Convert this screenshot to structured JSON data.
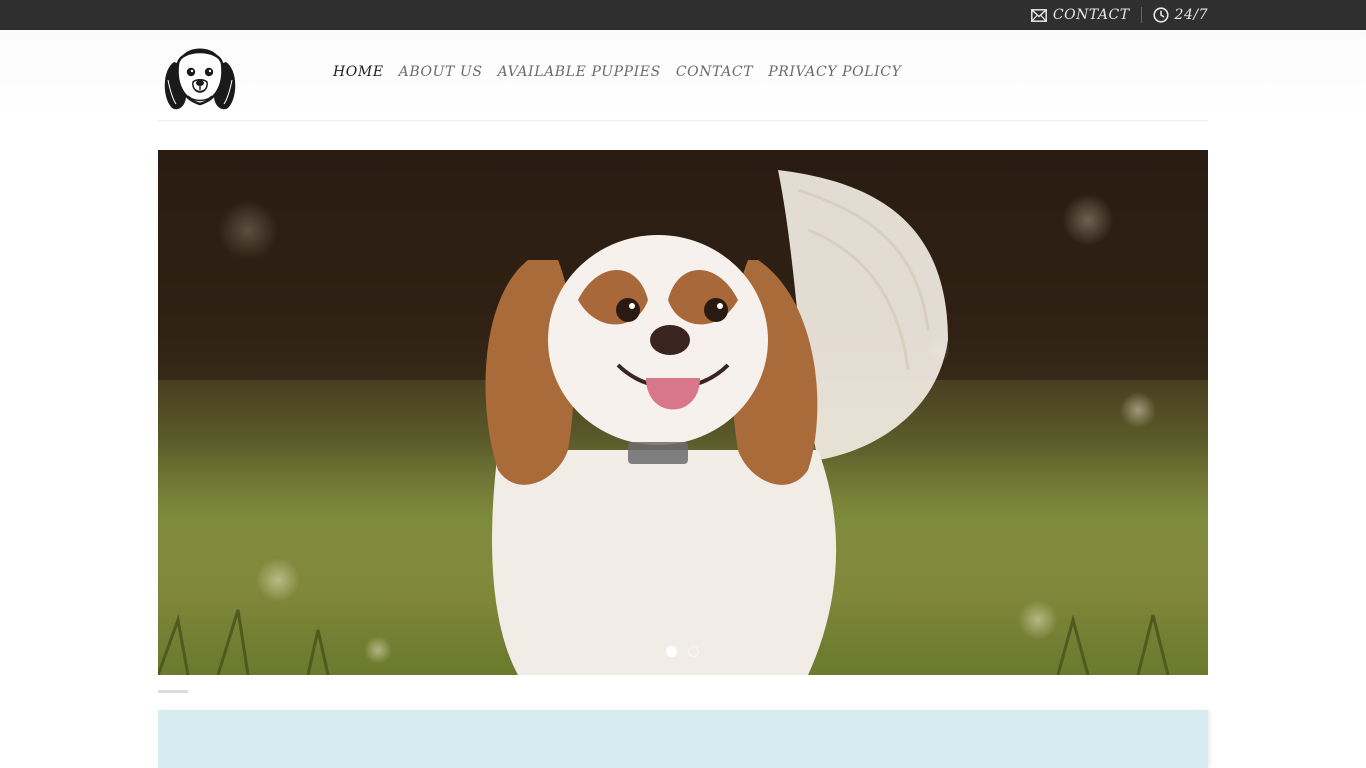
{
  "topbar": {
    "contact_label": "CONTACT",
    "hours_label": "24/7",
    "contact_icon": "envelope-icon",
    "hours_icon": "clock-icon"
  },
  "logo": {
    "icon": "spaniel-dog-head-logo"
  },
  "nav": {
    "items": [
      {
        "label": "HOME",
        "active": true
      },
      {
        "label": "ABOUT US",
        "active": false
      },
      {
        "label": "AVAILABLE PUPPIES",
        "active": false
      },
      {
        "label": "CONTACT",
        "active": false
      },
      {
        "label": "PRIVACY POLICY",
        "active": false
      }
    ]
  },
  "slider": {
    "slide_count": 2,
    "active_index": 0,
    "image_subject": "cavalier-king-charles-spaniel-running-on-grass"
  },
  "colors": {
    "topbar_bg": "#2f2f2f",
    "panel_blue": "#d6ecf1",
    "nav_active": "#1f1f1f",
    "nav_text": "#6b6b6b"
  }
}
